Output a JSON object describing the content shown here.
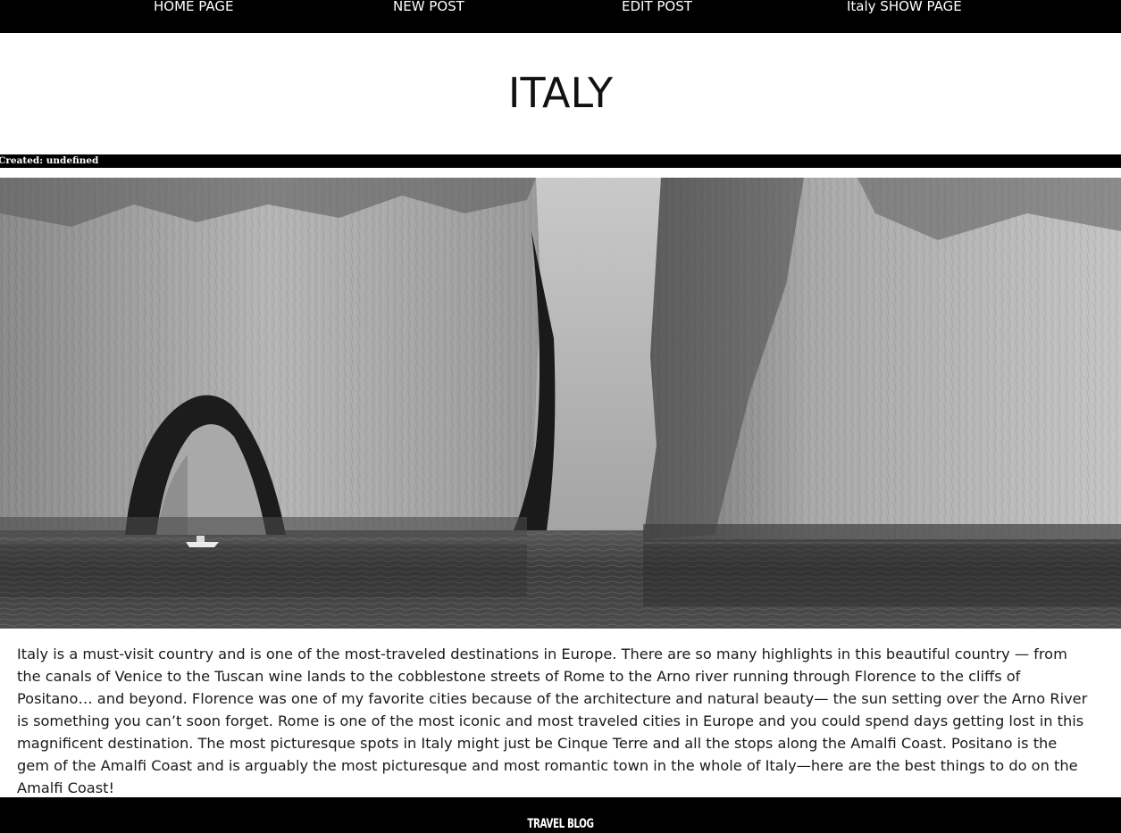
{
  "nav": {
    "items": [
      {
        "label": "HOME PAGE"
      },
      {
        "label": "NEW POST"
      },
      {
        "label": "EDIT POST"
      },
      {
        "label": "Italy SHOW PAGE"
      }
    ]
  },
  "page": {
    "title": "ITALY",
    "created": "Created: undefined"
  },
  "hero": {
    "alt": "Black and white photo of Faraglioni rock arch and cliffs over the sea"
  },
  "post": {
    "body": "Italy is a must-visit country and is one of the most-traveled destinations in Europe. There are so many highlights in this beautiful country — from the canals of Venice to the Tuscan wine lands to the cobblestone streets of Rome to the Arno river running through Florence to the cliffs of Positano… and beyond. Florence was one of my favorite cities because of the architecture and natural beauty— the sun setting over the Arno River is something you can’t soon forget. Rome is one of the most iconic and most traveled cities in Europe and you could spend days getting lost in this magnificent destination. The most picturesque spots in Italy might just be Cinque Terre and all the stops along the Amalfi Coast. Positano is the gem of the Amalfi Coast and is arguably the most picturesque and most romantic town in the whole of Italy—here are the best things to do on the Amalfi Coast!"
  },
  "footer": {
    "label": "TRAVEL BLOG"
  },
  "colors": {
    "nav_bg": "#000000",
    "nav_text": "#ffffff",
    "page_bg": "#ffffff",
    "body_text": "#1a1a1a"
  }
}
